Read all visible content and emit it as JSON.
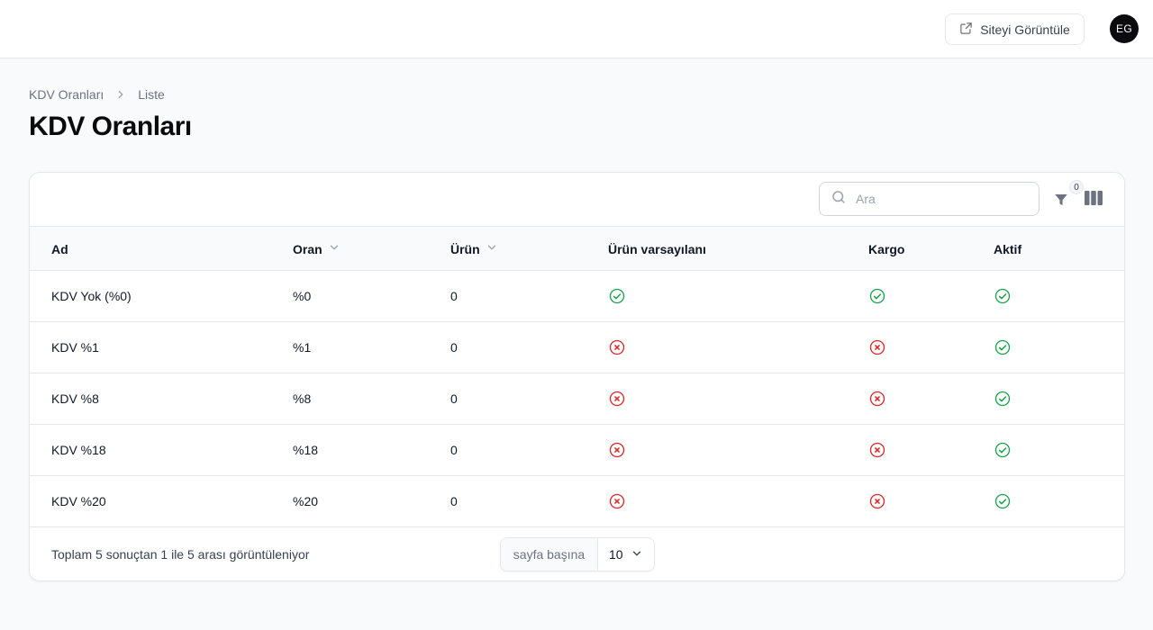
{
  "header": {
    "view_site_label": "Siteyi Görüntüle",
    "avatar_initials": "EG"
  },
  "breadcrumb": {
    "items": [
      "KDV Oranları",
      "Liste"
    ]
  },
  "page": {
    "title": "KDV Oranları"
  },
  "toolbar": {
    "search_placeholder": "Ara",
    "search_value": "",
    "filter_count": "0",
    "icons": [
      "search-icon",
      "filter-icon",
      "columns-icon"
    ]
  },
  "table": {
    "columns": {
      "ad": "Ad",
      "oran": "Oran",
      "urun": "Ürün",
      "varsayilan": "Ürün varsayılanı",
      "kargo": "Kargo",
      "aktif": "Aktif"
    },
    "rows": [
      {
        "ad": "KDV Yok (%0)",
        "oran": "%0",
        "urun": "0",
        "varsayilan": true,
        "kargo": true,
        "aktif": true
      },
      {
        "ad": "KDV %1",
        "oran": "%1",
        "urun": "0",
        "varsayilan": false,
        "kargo": false,
        "aktif": true
      },
      {
        "ad": "KDV %8",
        "oran": "%8",
        "urun": "0",
        "varsayilan": false,
        "kargo": false,
        "aktif": true
      },
      {
        "ad": "KDV %18",
        "oran": "%18",
        "urun": "0",
        "varsayilan": false,
        "kargo": false,
        "aktif": true
      },
      {
        "ad": "KDV %20",
        "oran": "%20",
        "urun": "0",
        "varsayilan": false,
        "kargo": false,
        "aktif": true
      }
    ]
  },
  "pagination": {
    "summary": "Toplam 5 sonuçtan 1 ile 5 arası görüntüleniyor",
    "per_page_label": "sayfa başına",
    "per_page_value": "10"
  },
  "colors": {
    "success": "#16a34a",
    "danger": "#dc2626"
  }
}
